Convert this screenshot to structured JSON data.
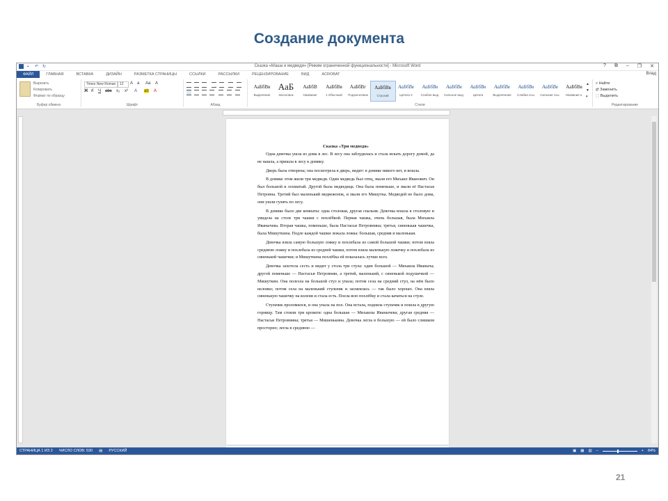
{
  "slide": {
    "title": "Создание документа",
    "page_number": "21"
  },
  "window": {
    "title": "Сказка «Маша и медведи» [Режим ограниченной функциональности] - Microsoft Word",
    "controls": [
      "?",
      "⧉",
      "–",
      "❐",
      "✕"
    ],
    "user": "Влад"
  },
  "quick_access": [
    "save-icon",
    "undo-icon",
    "redo-icon"
  ],
  "tabs": [
    "ФАЙЛ",
    "ГЛАВНАЯ",
    "ВСТАВКА",
    "ДИЗАЙН",
    "РАЗМЕТКА СТРАНИЦЫ",
    "ССЫЛКИ",
    "РАССЫЛКИ",
    "РЕЦЕНЗИРОВАНИЕ",
    "ВИД",
    "ACROBAT"
  ],
  "active_tab": 0,
  "ribbon": {
    "clipboard": {
      "cut": "Вырезать",
      "copy": "Копировать",
      "format_painter": "Формат по образцу",
      "label": "Буфер обмена"
    },
    "font": {
      "name": "Times New Roman",
      "size": "12",
      "label": "Шрифт"
    },
    "paragraph": {
      "label": "Абзац"
    },
    "styles": {
      "label": "Стили",
      "items": [
        {
          "sample": "АаБбВв",
          "name": "Выделение"
        },
        {
          "sample": "АаБ",
          "name": "Заголовок"
        },
        {
          "sample": "АаБбВ",
          "name": "Название"
        },
        {
          "sample": "АаБбВв",
          "name": "1 Обычный"
        },
        {
          "sample": "АаБбВг",
          "name": "Подзаголовок"
        },
        {
          "sample": "АаБбВв",
          "name": "Строгий"
        },
        {
          "sample": "АаБбВв",
          "name": "Цитата 2"
        },
        {
          "sample": "АаБбВв",
          "name": "Слабое выд."
        },
        {
          "sample": "АаБбВв",
          "name": "Сильное выд."
        },
        {
          "sample": "АаБбВв",
          "name": "Цитата"
        },
        {
          "sample": "АаБбВв",
          "name": "Выделенная"
        },
        {
          "sample": "АаБбВв",
          "name": "Слабая ссы."
        },
        {
          "sample": "АаБбВв",
          "name": "Сильная ссы."
        },
        {
          "sample": "АаБбВв",
          "name": "Название к."
        }
      ],
      "selected": 5
    },
    "editing": {
      "find": "Найти",
      "replace": "Заменить",
      "select": "Выделить",
      "label": "Редактирование"
    }
  },
  "document": {
    "heading": "Сказка «Три медведя»",
    "paragraphs": [
      "Одна девочка ушла из дома в лес. В лесу она заблудилась и стала искать дорогу домой, да не нашла, а пришла в лесу к домику.",
      "Дверь была отворена; она посмотрела в дверь, видит: в домике никого нет, и вошла.",
      "В домике этом жили три медведя. Один медведь был отец, звали его Михаил Иванович. Он был большой и лохматый. Другой была медведица. Она была поменьше, и звали её Настасья Петровна. Третий был маленький медвежонок, и звали его Мишутка. Медведей не было дома, они ушли гулять по лесу.",
      "В домике было две комнаты: одна столовая, другая спальня. Девочка вошла в столовую и увидела на столе три чашки с похлёбкой. Первая чашка, очень большая, была Михаила Иванычева. Вторая чашка, поменьше, была Настасьи Петровнина; третья, синенькая чашечка, была Мишуткина. Подле каждой чашки лежала ложка: большая, средняя и маленькая.",
      "Девочка взяла самую большую ложку и похлебала из самой большой чашки; потом взяла среднюю ложку и похлебала из средней чашки, потом взяла маленькую ложечку и похлебала из синенькой чашечки; и Мишуткина похлёбка ей показалась лучше всех.",
      "Девочка захотела сесть и видит у стола три стула: один большой — Михаила Иваныча; другой поменьше — Настасьи Петровнин, а третий, маленький, с синенькой подушечкой — Мишуткин. Она полезла на большой стул и упала; потом села на средний стул, на нём было неловко; потом села на маленький стульчик и засмеялась — так было хорошо. Она взяла синенькую чашечку на колени и стала есть. Поела всю похлёбку и стала качаться на стуле.",
      "Стульчик проломился, и она упала на пол. Она встала, подняла стульчик и пошла в другую горницу. Там стояли три кровати: одна большая — Михаилы Иванычева; другая средняя — Настасьи Петровнина; третья — Мишенькина. Девочка легла в большую — ей было слишком просторно; легла в среднюю —"
    ]
  },
  "statusbar": {
    "page": "СТРАНИЦА 1 ИЗ 2",
    "words": "ЧИСЛО СЛОВ: 530",
    "language": "РУССКИЙ",
    "zoom": "84%",
    "zoom_level": 0.42
  },
  "colors": {
    "accent": "#2b579a",
    "slide_title": "#2e5a86"
  }
}
